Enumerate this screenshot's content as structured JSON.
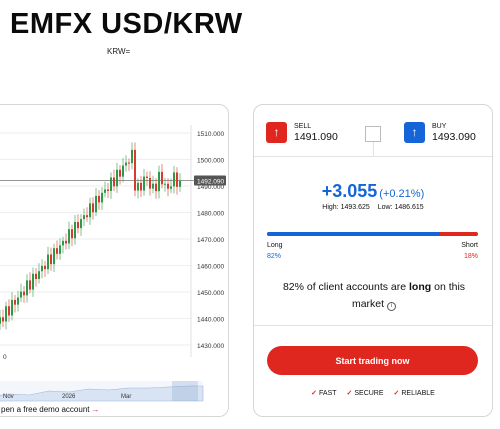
{
  "header": {
    "title": "EMFX USD/KRW",
    "subtitle": "KRW="
  },
  "chart": {
    "price_ticks": [
      "1510.000",
      "1500.000",
      "1490.000",
      "1480.000",
      "1470.000",
      "1460.000",
      "1450.000",
      "1440.000",
      "1430.000"
    ],
    "current_price": "1492.090",
    "x_labels": [
      "0"
    ],
    "nav_labels": [
      "Nov",
      "2026",
      "Mar"
    ],
    "demo_link": "pen a free demo account",
    "demo_arrow": "→",
    "colors": {
      "up": "#2e9a45",
      "down": "#d93a2f",
      "accent": "#e0271f"
    }
  },
  "trade": {
    "sell_label": "SELL",
    "sell_price": "1491.090",
    "buy_label": "BUY",
    "buy_price": "1493.090",
    "change": "+3.055",
    "change_pct": "(+0.21%)",
    "high": "High: 1493.625",
    "low": "Low: 1486.615",
    "long_label": "Long",
    "long_pct": "82%",
    "short_label": "Short",
    "short_pct": "18%",
    "long_fraction": 0.82,
    "sentiment_pre": "82% of client accounts are ",
    "sentiment_bold": "long",
    "sentiment_post": " on this market",
    "start_button": "Start trading now",
    "features": [
      "FAST",
      "SECURE",
      "RELIABLE"
    ],
    "colors": {
      "sell": "#e0271f",
      "buy": "#1565d8"
    },
    "icons": {
      "sell": "arrow-up-icon",
      "buy": "arrow-up-icon",
      "info": "info-icon",
      "check": "check-icon"
    }
  }
}
